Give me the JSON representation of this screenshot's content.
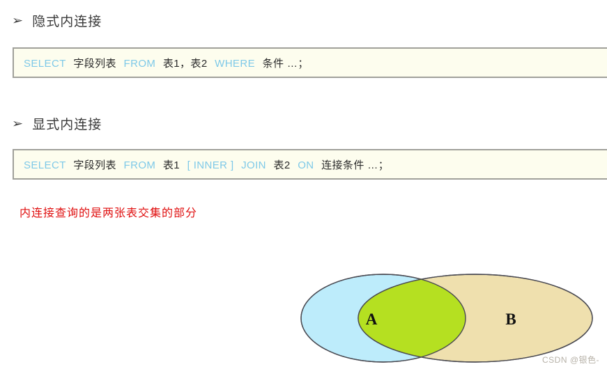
{
  "document": {
    "sections": [
      {
        "bullet": "➢",
        "heading": "隐式内连接",
        "code_tokens": [
          {
            "text": "SELECT",
            "type": "keyword"
          },
          {
            "text": "字段列表",
            "type": "plain"
          },
          {
            "text": "FROM",
            "type": "keyword"
          },
          {
            "text": "表1，表2",
            "type": "plain"
          },
          {
            "text": "WHERE",
            "type": "keyword"
          },
          {
            "text": "条件 …；",
            "type": "plain"
          }
        ]
      },
      {
        "bullet": "➢",
        "heading": "显式内连接",
        "code_tokens": [
          {
            "text": "SELECT",
            "type": "keyword"
          },
          {
            "text": "字段列表",
            "type": "plain"
          },
          {
            "text": "FROM",
            "type": "keyword"
          },
          {
            "text": "表1",
            "type": "plain"
          },
          {
            "text": "[ INNER ]",
            "type": "keyword"
          },
          {
            "text": "JOIN",
            "type": "keyword"
          },
          {
            "text": "表2",
            "type": "plain"
          },
          {
            "text": "ON",
            "type": "keyword"
          },
          {
            "text": "连接条件 …；",
            "type": "plain"
          }
        ]
      }
    ],
    "note": {
      "text": "内连接查询的是两张表交集的部分",
      "color": "#e01010"
    },
    "watermark": "CSDN @银色-"
  },
  "venn": {
    "title": "inner-join-set-intersection",
    "left_label": "A",
    "right_label": "B",
    "left_fill": "#bdecfb",
    "right_fill": "#efe0ae",
    "intersection_fill": "#b5e021",
    "stroke": "#4a4a52"
  },
  "colors": {
    "code_background": "#fdfdee",
    "code_border": "#a0a09a",
    "keyword": "#7ec9e8",
    "plain_text": "#2b2b2b",
    "heading": "#3a3a3a",
    "watermark": "#b7b2a8",
    "page_background": "#ffffff"
  }
}
